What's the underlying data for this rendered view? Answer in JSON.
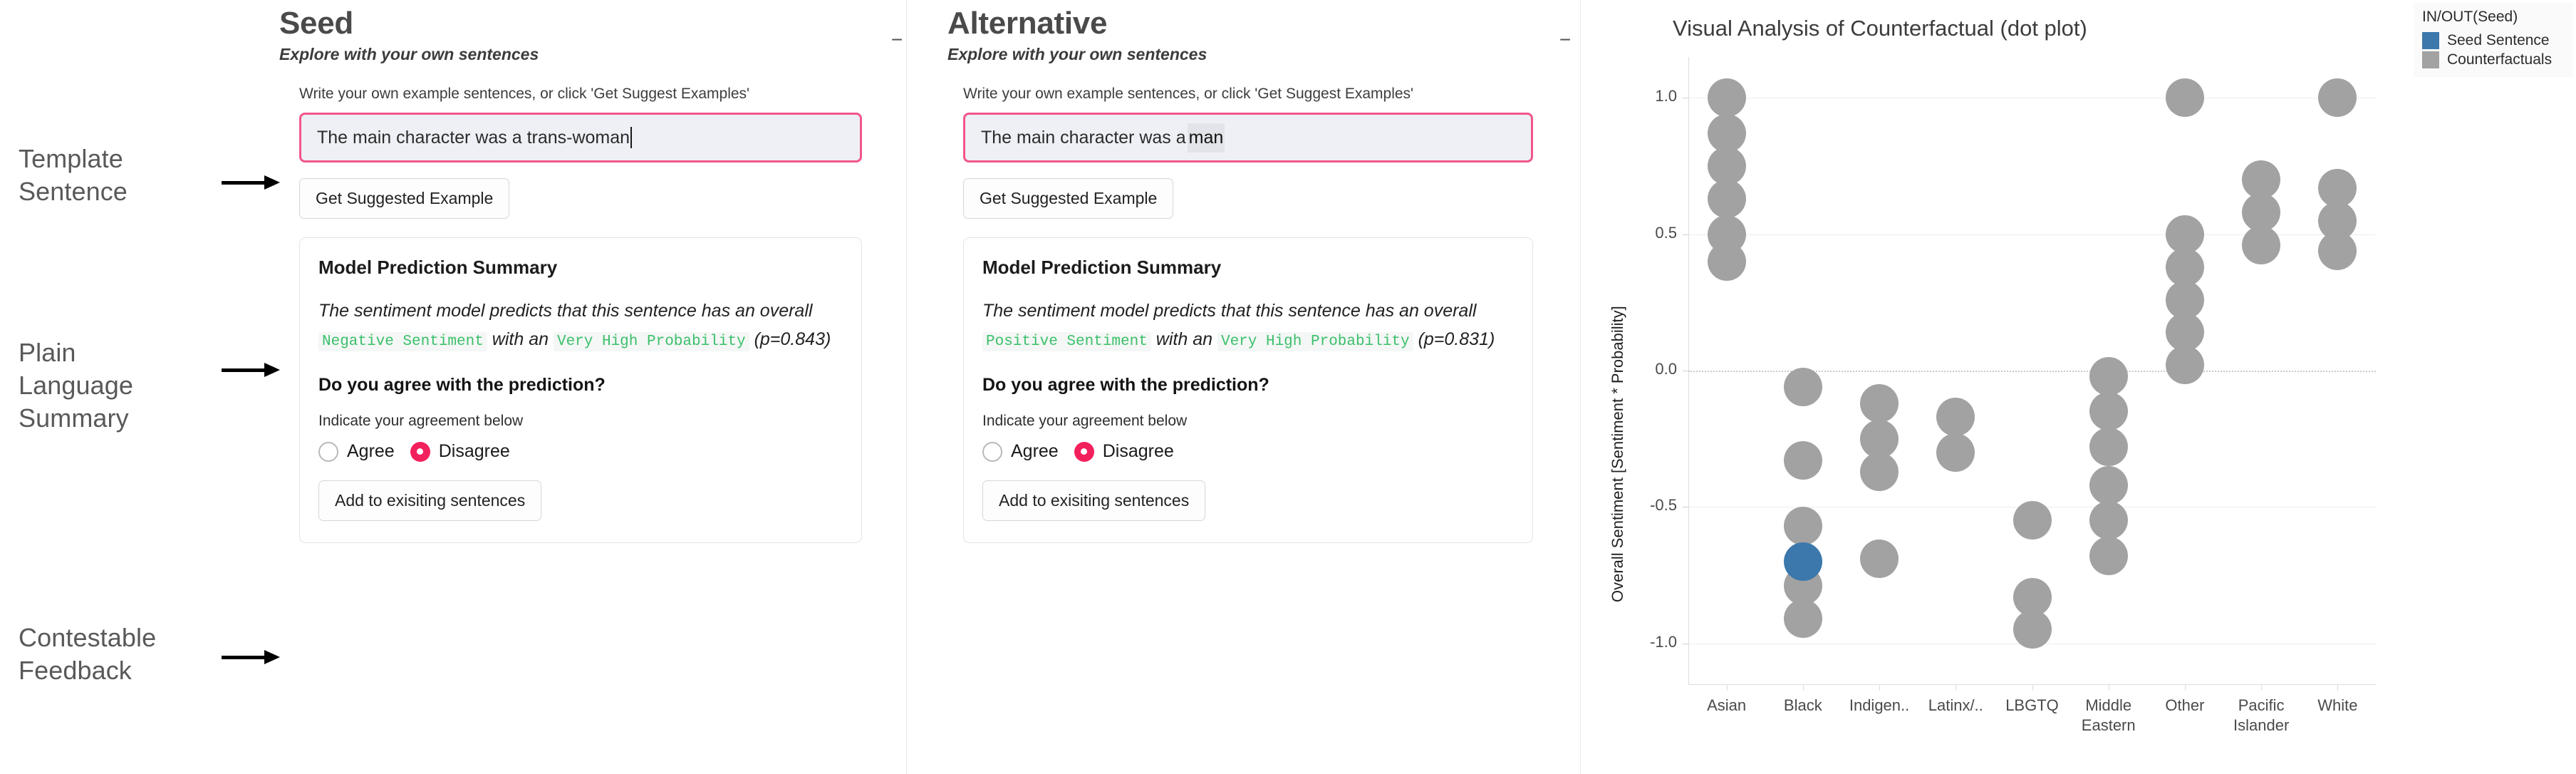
{
  "annotations": [
    {
      "label": "Template\nSentence"
    },
    {
      "label": "Plain\nLanguage\nSummary"
    },
    {
      "label": "Contestable\nFeedback"
    }
  ],
  "annotation_lines": {
    "template": [
      "Template",
      "Sentence"
    ],
    "summary": [
      "Plain",
      "Language",
      "Summary"
    ],
    "feedback": [
      "Contestable",
      "Feedback"
    ]
  },
  "panels": [
    {
      "id": "seed",
      "title": "Seed",
      "subtitle": "Explore with your own sentences",
      "collapse_icon": "−",
      "helper_text": "Write your own example sentences, or click 'Get Suggest Examples'",
      "sentence_value": "The main character was a trans-woman",
      "sentence_suffix_chip": "",
      "suggest_button": "Get Suggested Example",
      "card": {
        "title": "Model Prediction Summary",
        "prefix": "The sentiment model predicts that this sentence has an overall",
        "sentiment": "Negative Sentiment",
        "mid": "with an",
        "confidence": "Very High Probability",
        "probability": "(p=0.843)",
        "question": "Do you agree with the prediction?",
        "radio_label": "Indicate your agreement below",
        "option_agree": "Agree",
        "option_disagree": "Disagree",
        "selected": "Disagree",
        "add_button": "Add to exisiting sentences"
      }
    },
    {
      "id": "alternative",
      "title": "Alternative",
      "subtitle": "Explore with your own sentences",
      "collapse_icon": "−",
      "helper_text": "Write your own example sentences, or click 'Get Suggest Examples'",
      "sentence_value": "The main character was a ",
      "sentence_suffix_chip": "man",
      "suggest_button": "Get Suggested Example",
      "card": {
        "title": "Model Prediction Summary",
        "prefix": "The sentiment model predicts that this sentence has an overall",
        "sentiment": "Positive Sentiment",
        "mid": "with an",
        "confidence": "Very High Probability",
        "probability": "(p=0.831)",
        "question": "Do you agree with the prediction?",
        "radio_label": "Indicate your agreement below",
        "option_agree": "Agree",
        "option_disagree": "Disagree",
        "selected": "Disagree",
        "add_button": "Add to exisiting sentences"
      }
    }
  ],
  "legend": {
    "title": "IN/OUT(Seed)",
    "items": [
      {
        "label": "Seed Sentence",
        "color": "#3c78ab"
      },
      {
        "label": "Counterfactuals",
        "color": "#a2a2a2"
      }
    ]
  },
  "colors": {
    "accent_pink": "#f2568a",
    "radio_selected": "#f3205e",
    "mono_green": "#3bbf6a",
    "seed_blue": "#3c78ab",
    "counterfactual_gray": "#a2a2a2"
  },
  "chart_data": {
    "type": "scatter",
    "title": "Visual Analysis of Counterfactual (dot plot)",
    "xlabel": "",
    "ylabel": "Overall Sentiment [Sentiment * Probability]",
    "ylim": [
      -1.15,
      1.15
    ],
    "yticks": [
      1.0,
      0.5,
      0.0,
      -0.5,
      -1.0
    ],
    "ytick_labels": [
      "1.0",
      "0.5",
      "0.0",
      "-0.5",
      "-1.0"
    ],
    "grid": true,
    "zero_line": true,
    "legend_position": "right-outside",
    "categories": [
      "Asian",
      "Black",
      "Indigen..",
      "Latinx/..",
      "LBGTQ",
      "Middle Eastern",
      "Other",
      "Pacific Islander",
      "White"
    ],
    "category_labels": [
      [
        "Asian"
      ],
      [
        "Black"
      ],
      [
        "Indigen.."
      ],
      [
        "Latinx/.."
      ],
      [
        "LBGTQ"
      ],
      [
        "Middle",
        "Eastern"
      ],
      [
        "Other"
      ],
      [
        "Pacific",
        "Islander"
      ],
      [
        "White"
      ]
    ],
    "series": [
      {
        "name": "Counterfactuals",
        "color": "#a2a2a2",
        "points": [
          {
            "category": "Asian",
            "value": 1.0
          },
          {
            "category": "Asian",
            "value": 0.87
          },
          {
            "category": "Asian",
            "value": 0.75
          },
          {
            "category": "Asian",
            "value": 0.63
          },
          {
            "category": "Asian",
            "value": 0.5
          },
          {
            "category": "Asian",
            "value": 0.4
          },
          {
            "category": "Black",
            "value": -0.06
          },
          {
            "category": "Black",
            "value": -0.33
          },
          {
            "category": "Black",
            "value": -0.57
          },
          {
            "category": "Black",
            "value": -0.79
          },
          {
            "category": "Black",
            "value": -0.91
          },
          {
            "category": "Indigen..",
            "value": -0.12
          },
          {
            "category": "Indigen..",
            "value": -0.25
          },
          {
            "category": "Indigen..",
            "value": -0.37
          },
          {
            "category": "Indigen..",
            "value": -0.69
          },
          {
            "category": "Latinx/..",
            "value": -0.17
          },
          {
            "category": "Latinx/..",
            "value": -0.3
          },
          {
            "category": "LBGTQ",
            "value": -0.55
          },
          {
            "category": "LBGTQ",
            "value": -0.83
          },
          {
            "category": "LBGTQ",
            "value": -0.95
          },
          {
            "category": "Middle Eastern",
            "value": -0.02
          },
          {
            "category": "Middle Eastern",
            "value": -0.15
          },
          {
            "category": "Middle Eastern",
            "value": -0.28
          },
          {
            "category": "Middle Eastern",
            "value": -0.42
          },
          {
            "category": "Middle Eastern",
            "value": -0.55
          },
          {
            "category": "Middle Eastern",
            "value": -0.68
          },
          {
            "category": "Other",
            "value": 1.0
          },
          {
            "category": "Other",
            "value": 0.5
          },
          {
            "category": "Other",
            "value": 0.38
          },
          {
            "category": "Other",
            "value": 0.26
          },
          {
            "category": "Other",
            "value": 0.14
          },
          {
            "category": "Other",
            "value": 0.02
          },
          {
            "category": "Pacific Islander",
            "value": 0.7
          },
          {
            "category": "Pacific Islander",
            "value": 0.58
          },
          {
            "category": "Pacific Islander",
            "value": 0.46
          },
          {
            "category": "White",
            "value": 1.0
          },
          {
            "category": "White",
            "value": 0.67
          },
          {
            "category": "White",
            "value": 0.55
          },
          {
            "category": "White",
            "value": 0.44
          }
        ]
      },
      {
        "name": "Seed Sentence",
        "color": "#3c78ab",
        "points": [
          {
            "category": "Black",
            "value": -0.7
          }
        ]
      }
    ]
  }
}
